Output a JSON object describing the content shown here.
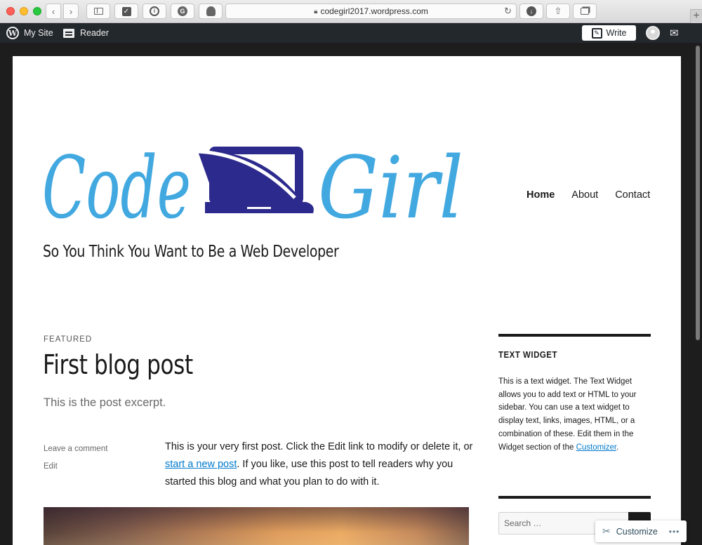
{
  "browser": {
    "url": "codegirl2017.wordpress.com",
    "plus_tab": "+"
  },
  "adminbar": {
    "my_site": "My Site",
    "reader": "Reader",
    "write": "Write"
  },
  "site": {
    "logo_text_left": "Code",
    "logo_text_right": "Girl",
    "tagline": "So You Think You Want to Be a Web Developer",
    "brand_blue": "#42a8e0",
    "brand_navy": "#2c2a8c"
  },
  "nav": {
    "items": [
      "Home",
      "About",
      "Contact"
    ],
    "current": "Home"
  },
  "post": {
    "label": "FEATURED",
    "title": "First blog post",
    "excerpt": "This is the post excerpt.",
    "meta": {
      "comment": "Leave a comment",
      "edit": "Edit"
    },
    "content_before_link": "This is your very first post. Click the Edit link to modify or delete it, or ",
    "content_link": "start a new post",
    "content_after_link": ". If you like, use this post to tell readers why you started this blog and what you plan to do with it."
  },
  "sidebar": {
    "widget_title": "TEXT WIDGET",
    "widget_text_before_link": "This is a text widget. The Text Widget allows you to add text or HTML to your sidebar. You can use a text widget to display text, links, images, HTML, or a combination of these. Edit them in the Widget section of the ",
    "widget_link": "Customizer",
    "widget_text_after_link": ".",
    "search_placeholder": "Search …"
  },
  "customize": {
    "label": "Customize"
  }
}
